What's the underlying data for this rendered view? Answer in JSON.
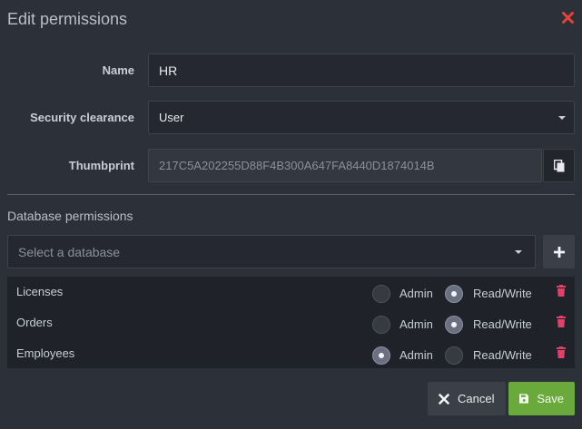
{
  "dialog": {
    "title": "Edit permissions"
  },
  "form": {
    "name_label": "Name",
    "name_value": "HR",
    "clearance_label": "Security clearance",
    "clearance_value": "User",
    "thumbprint_label": "Thumbprint",
    "thumbprint_value": "217C5A202255D88F4B300A647FA8440D1874014B"
  },
  "database_permissions": {
    "section_title": "Database permissions",
    "select_placeholder": "Select a database",
    "option_admin": "Admin",
    "option_readwrite": "Read/Write",
    "rows": [
      {
        "name": "Licenses",
        "access": "Read/Write"
      },
      {
        "name": "Orders",
        "access": "Read/Write"
      },
      {
        "name": "Employees",
        "access": "Admin"
      }
    ]
  },
  "buttons": {
    "cancel": "Cancel",
    "save": "Save"
  },
  "colors": {
    "close": "#e8413a",
    "trash": "#e0406a",
    "save": "#6aaa3c"
  },
  "icons": {
    "close": "close-icon",
    "copy": "copy-icon",
    "add": "plus-icon",
    "delete": "trash-icon",
    "cancel": "x-icon",
    "save": "floppy-disk-icon"
  }
}
